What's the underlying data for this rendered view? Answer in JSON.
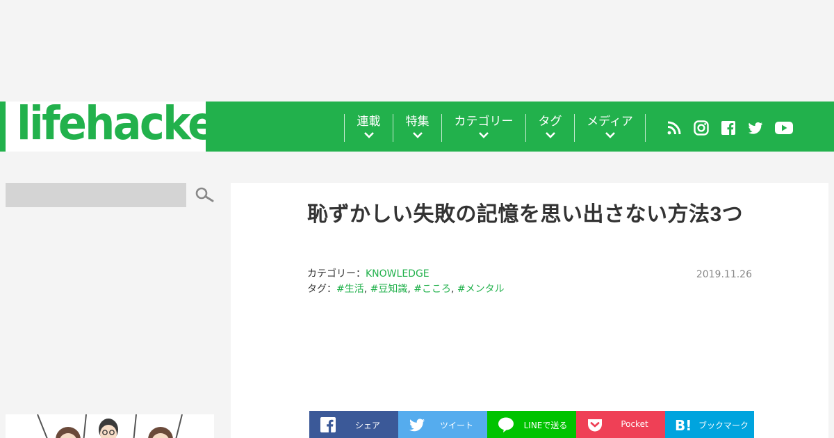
{
  "header": {
    "logo": "lifehacker",
    "nav": [
      {
        "label": "連載"
      },
      {
        "label": "特集"
      },
      {
        "label": "カテゴリー"
      },
      {
        "label": "タグ"
      },
      {
        "label": "メディア"
      }
    ],
    "social_icons": [
      "rss-icon",
      "instagram-icon",
      "facebook-icon",
      "twitter-icon",
      "youtube-icon"
    ]
  },
  "sidebar": {
    "search_placeholder": ""
  },
  "article": {
    "title": "恥ずかしい失敗の記憶を思い出さない方法3つ",
    "category_label": "カテゴリー：",
    "category": "KNOWLEDGE",
    "tag_label": "タグ：",
    "tags": [
      "#生活",
      "#豆知識",
      "#こころ",
      "#メンタル"
    ],
    "tag_separator": ",",
    "date": "2019.11.26"
  },
  "share": [
    {
      "label": "シェア",
      "color": "#3b5998",
      "icon": "facebook-icon"
    },
    {
      "label": "ツイート",
      "color": "#55acee",
      "icon": "twitter-icon"
    },
    {
      "label": "LINEで送る",
      "color": "#00c300",
      "icon": "line-icon"
    },
    {
      "label": "Pocket",
      "color": "#ef4056",
      "icon": "pocket-icon"
    },
    {
      "label": "ブックマーク",
      "color": "#00a4de",
      "icon": "hatena-bookmark-icon"
    }
  ],
  "colors": {
    "brand": "#22b14c",
    "background": "#f4f4f4"
  }
}
